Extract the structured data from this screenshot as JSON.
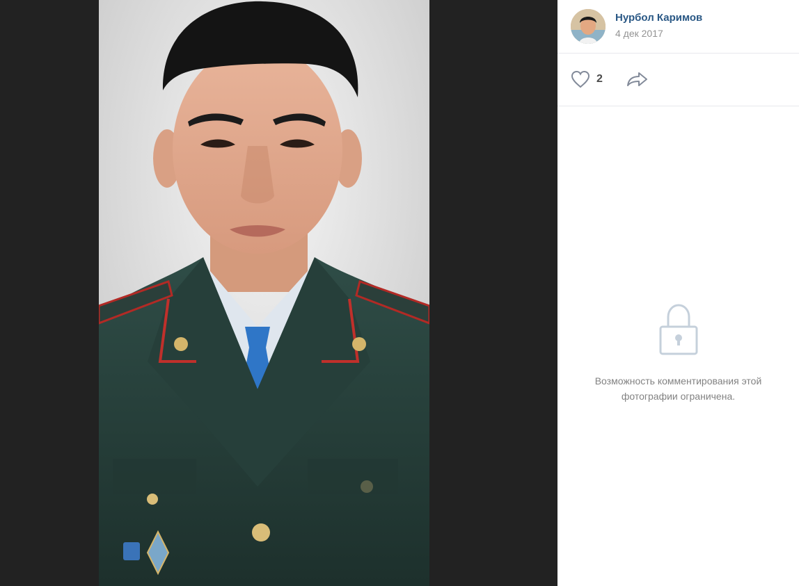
{
  "viewer": {
    "photo_icon": "portrait-photo"
  },
  "sidebar": {
    "author": {
      "name": "Нурбол Каримов",
      "date": "4 дек 2017",
      "avatar_icon": "user-avatar"
    },
    "actions": {
      "like_icon": "heart-icon",
      "like_count": "2",
      "share_icon": "share-arrow-icon"
    },
    "comments": {
      "lock_icon": "lock-icon",
      "restricted_text": "Возможность комментирования этой фотографии ограничена."
    }
  },
  "colors": {
    "link": "#2a5885",
    "muted": "#939393",
    "icon": "#828a99",
    "lock": "#c5d0db",
    "viewer_bg": "#222222"
  }
}
